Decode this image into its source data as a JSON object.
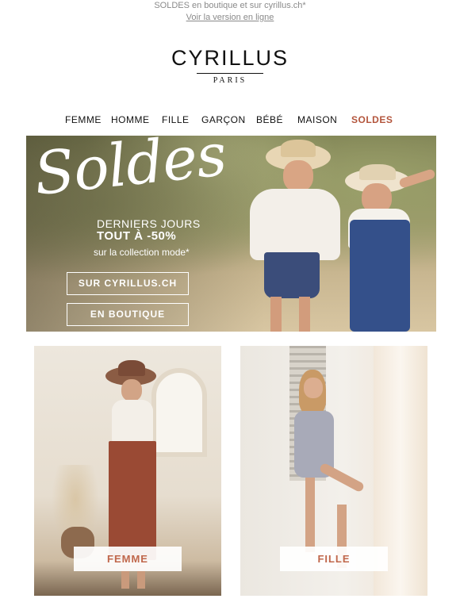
{
  "preheader": {
    "text": "SOLDES en boutique et sur cyrillus.ch*",
    "online_link": "Voir la version en ligne"
  },
  "logo": {
    "wordmark": "CYRILLUS",
    "tagline": "PARIS"
  },
  "nav": {
    "items": [
      "FEMME",
      "HOMME",
      "FILLE",
      "GARÇON",
      "BÉBÉ",
      "MAISON",
      "SOLDES"
    ]
  },
  "hero": {
    "script_title": "Soldes",
    "line1": "DERNIERS JOURS",
    "line2": "TOUT À -50%",
    "line3": "sur la collection mode*",
    "button_online": "SUR CYRILLUS.CH",
    "button_store": "EN BOUTIQUE"
  },
  "tiles": [
    {
      "label": "FEMME"
    },
    {
      "label": "FILLE"
    }
  ],
  "colors": {
    "sale_accent": "#b3553c",
    "tile_label": "#c0674b"
  }
}
